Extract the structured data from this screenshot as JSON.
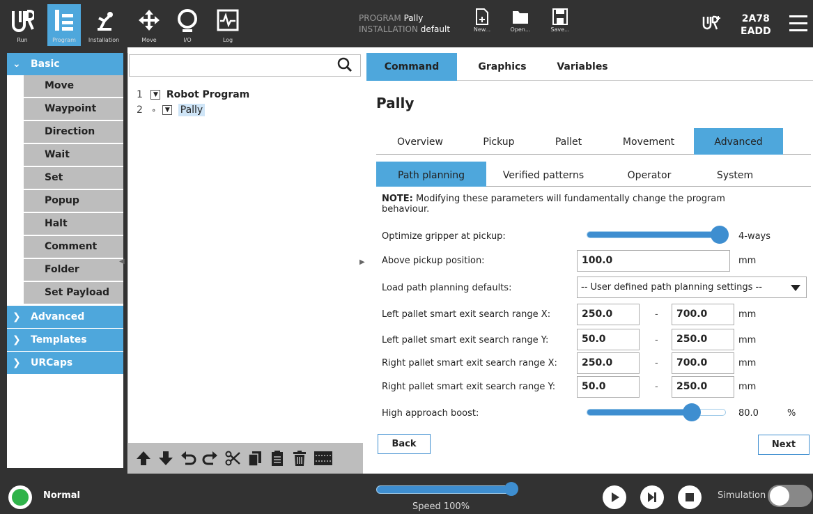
{
  "topbar": {
    "nav": [
      {
        "label": "Run",
        "icon": "ur-logo-icon"
      },
      {
        "label": "Program",
        "icon": "program-icon"
      },
      {
        "label": "Installation",
        "icon": "installation-icon"
      },
      {
        "label": "Move",
        "icon": "move-icon"
      },
      {
        "label": "I/O",
        "icon": "io-icon"
      },
      {
        "label": "Log",
        "icon": "log-icon"
      }
    ],
    "program_key": "PROGRAM",
    "program_value": "Pally",
    "installation_key": "INSTALLATION",
    "installation_value": "default",
    "file_buttons": [
      {
        "label": "New...",
        "icon": "new-file-icon"
      },
      {
        "label": "Open...",
        "icon": "open-folder-icon"
      },
      {
        "label": "Save...",
        "icon": "save-icon"
      }
    ],
    "serial_line1": "2A78",
    "serial_line2": "EADD"
  },
  "sidebar": {
    "basic_label": "Basic",
    "items": [
      {
        "label": "Move"
      },
      {
        "label": "Waypoint"
      },
      {
        "label": "Direction"
      },
      {
        "label": "Wait"
      },
      {
        "label": "Set"
      },
      {
        "label": "Popup"
      },
      {
        "label": "Halt"
      },
      {
        "label": "Comment"
      },
      {
        "label": "Folder"
      },
      {
        "label": "Set Payload"
      }
    ],
    "categories": [
      {
        "label": "Advanced"
      },
      {
        "label": "Templates"
      },
      {
        "label": "URCaps"
      }
    ]
  },
  "tree": {
    "search_placeholder": "",
    "lines": [
      {
        "num": "1",
        "label": "Robot Program"
      },
      {
        "num": "2",
        "label": "Pally"
      }
    ]
  },
  "command_tabs": [
    {
      "label": "Command"
    },
    {
      "label": "Graphics"
    },
    {
      "label": "Variables"
    }
  ],
  "page_title": "Pally",
  "sub_tabs": [
    {
      "label": "Overview"
    },
    {
      "label": "Pickup"
    },
    {
      "label": "Pallet"
    },
    {
      "label": "Movement"
    },
    {
      "label": "Advanced"
    }
  ],
  "sub_tabs2": [
    {
      "label": "Path planning"
    },
    {
      "label": "Verified patterns"
    },
    {
      "label": "Operator"
    },
    {
      "label": "System"
    }
  ],
  "note": {
    "bold": "NOTE:",
    "text": " Modifying these parameters will fundamentally change the program behaviour."
  },
  "form": {
    "optimize_label": "Optimize gripper at pickup:",
    "optimize_value": "4-ways",
    "optimize_level": 1.0,
    "above_label": "Above pickup position:",
    "above_value": "100.0",
    "above_unit": "mm",
    "defaults_label": "Load path planning defaults:",
    "defaults_value": "-- User defined path planning settings --",
    "ranges": [
      {
        "label": "Left pallet smart exit search range X:",
        "min": "250.0",
        "max": "700.0",
        "unit": "mm"
      },
      {
        "label": "Left pallet smart exit search range Y:",
        "min": "50.0",
        "max": "250.0",
        "unit": "mm"
      },
      {
        "label": "Right pallet smart exit search range X:",
        "min": "250.0",
        "max": "700.0",
        "unit": "mm"
      },
      {
        "label": "Right pallet smart exit search range Y:",
        "min": "50.0",
        "max": "250.0",
        "unit": "mm"
      }
    ],
    "dash": "-",
    "boost_label": "High approach boost:",
    "boost_value": "80.0",
    "boost_unit": "%",
    "boost_level": 0.8
  },
  "buttons": {
    "back": "Back",
    "next": "Next"
  },
  "bottombar": {
    "status": "Normal",
    "speed_label": "Speed 100%",
    "speed_level": 1.0,
    "simulation_label": "Simulation"
  },
  "colors": {
    "accent": "#4ea7dc",
    "dark": "#323232",
    "status_green": "#2fb34a"
  }
}
